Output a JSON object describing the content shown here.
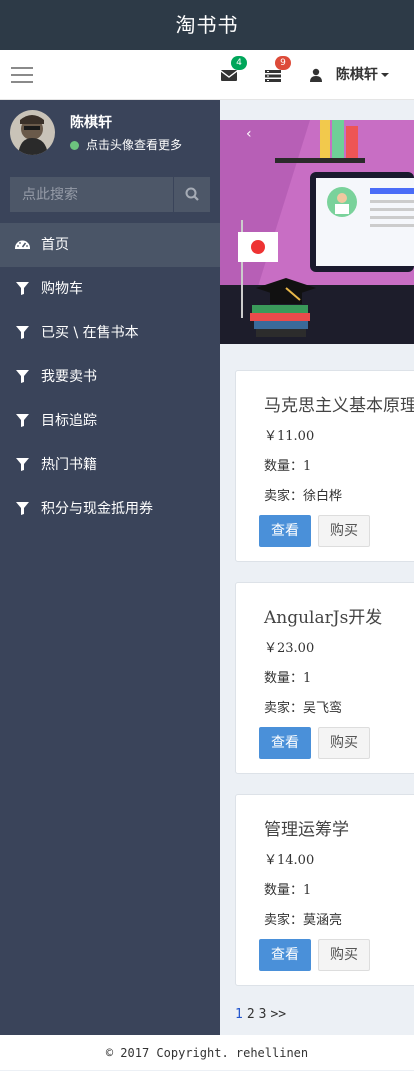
{
  "app": {
    "title": "淘书书"
  },
  "navbar": {
    "mail_badge": "4",
    "list_badge": "9",
    "user_name": "陈棋轩",
    "colors": {
      "mail_badge": "#00a65a",
      "list_badge": "#dd4b39"
    }
  },
  "sidebar": {
    "user_name": "陈棋轩",
    "status_text": "点击头像查看更多",
    "search_placeholder": "点此搜索",
    "items": [
      {
        "label": "首页",
        "icon": "dashboard-icon"
      },
      {
        "label": "购物车",
        "icon": "filter-icon"
      },
      {
        "label": "已买 \\ 在售书本",
        "icon": "filter-icon"
      },
      {
        "label": "我要卖书",
        "icon": "filter-icon"
      },
      {
        "label": "目标追踪",
        "icon": "filter-icon"
      },
      {
        "label": "热门书籍",
        "icon": "filter-icon"
      },
      {
        "label": "积分与现金抵用券",
        "icon": "filter-icon"
      }
    ]
  },
  "books": [
    {
      "title": "马克思主义基本原理",
      "price": "￥11.00",
      "quantity": "数量：1",
      "seller": "卖家：徐白桦",
      "view_label": "查看",
      "buy_label": "购买"
    },
    {
      "title": "AngularJs开发",
      "price": "￥23.00",
      "quantity": "数量：1",
      "seller": "卖家：吴飞鸾",
      "view_label": "查看",
      "buy_label": "购买"
    },
    {
      "title": "管理运筹学",
      "price": "￥14.00",
      "quantity": "数量：1",
      "seller": "卖家：莫涵亮",
      "view_label": "查看",
      "buy_label": "购买"
    }
  ],
  "pager": {
    "pages": [
      "1",
      "2",
      "3"
    ],
    "next": ">>"
  },
  "footer": {
    "text": "© 2017 Copyright. rehellinen"
  },
  "theme": {
    "topbar": "#2d3a47",
    "sidebar": "#3a445a",
    "accent": "#4a90d9"
  }
}
